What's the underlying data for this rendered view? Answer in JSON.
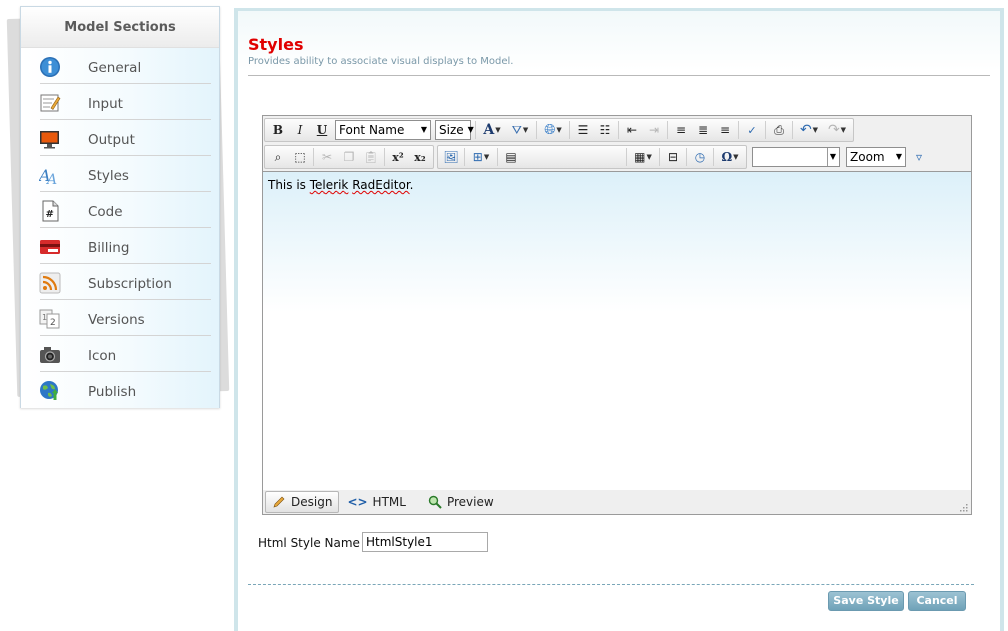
{
  "sidebar": {
    "title": "Model Sections",
    "items": [
      {
        "label": "General",
        "icon": "info-icon"
      },
      {
        "label": "Input",
        "icon": "input-form-icon"
      },
      {
        "label": "Output",
        "icon": "monitor-icon"
      },
      {
        "label": "Styles",
        "icon": "font-styles-icon"
      },
      {
        "label": "Code",
        "icon": "code-file-icon"
      },
      {
        "label": "Billing",
        "icon": "credit-card-icon"
      },
      {
        "label": "Subscription",
        "icon": "rss-subscription-icon"
      },
      {
        "label": "Versions",
        "icon": "versions-icon"
      },
      {
        "label": "Icon",
        "icon": "camera-icon"
      },
      {
        "label": "Publish",
        "icon": "globe-publish-icon"
      }
    ]
  },
  "page": {
    "title": "Styles",
    "subtitle": "Provides ability to associate visual displays to Model."
  },
  "editor": {
    "font_name": "Font Name",
    "size": "Size",
    "zoom": "Zoom",
    "custom_select": "",
    "content": {
      "before": "This is ",
      "word1": "Telerik",
      "space": " ",
      "word2": "RadEditor",
      "after": "."
    },
    "modes": {
      "design": "Design",
      "html": "HTML",
      "preview": "Preview"
    }
  },
  "form": {
    "style_name_label": "Html Style Name :",
    "style_name_value": "HtmlStyle1"
  },
  "buttons": {
    "save": "Save Style",
    "cancel": "Cancel"
  },
  "colors": {
    "title_red": "#e00000",
    "button_blue": "#7fb0c4",
    "frame_teal": "#cfe5ea"
  }
}
